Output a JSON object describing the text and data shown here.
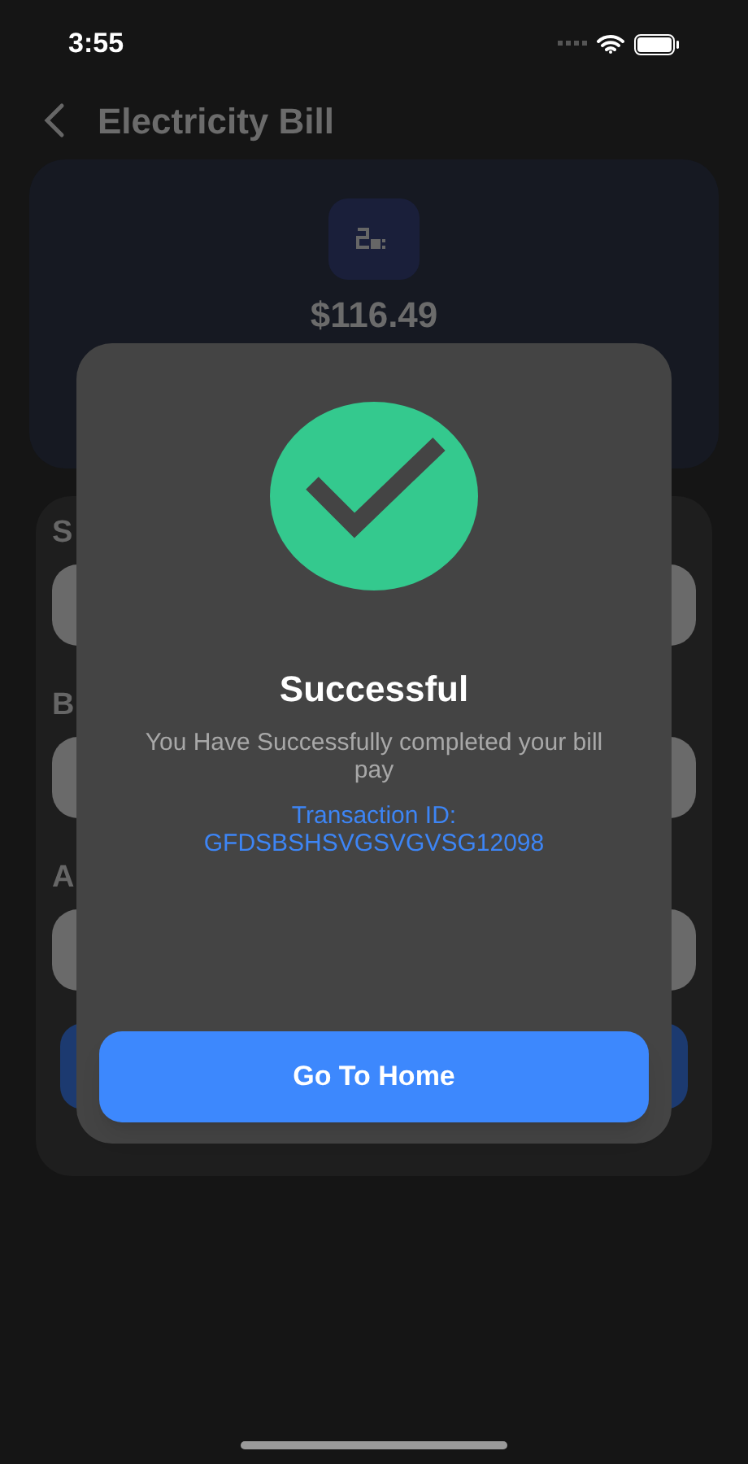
{
  "status_bar": {
    "time": "3:55"
  },
  "header": {
    "title": "Electricity Bill"
  },
  "summary": {
    "amount": "$116.49"
  },
  "form": {
    "fields": [
      {
        "label": "S"
      },
      {
        "label": "B"
      },
      {
        "label": "A"
      }
    ]
  },
  "dialog": {
    "title": "Successful",
    "message": "You Have  Successfully completed your bill pay",
    "transaction_label": "Transaction ID:",
    "transaction_id": "GFDSBSHSVGSVGVSG12098",
    "button": "Go To Home"
  }
}
